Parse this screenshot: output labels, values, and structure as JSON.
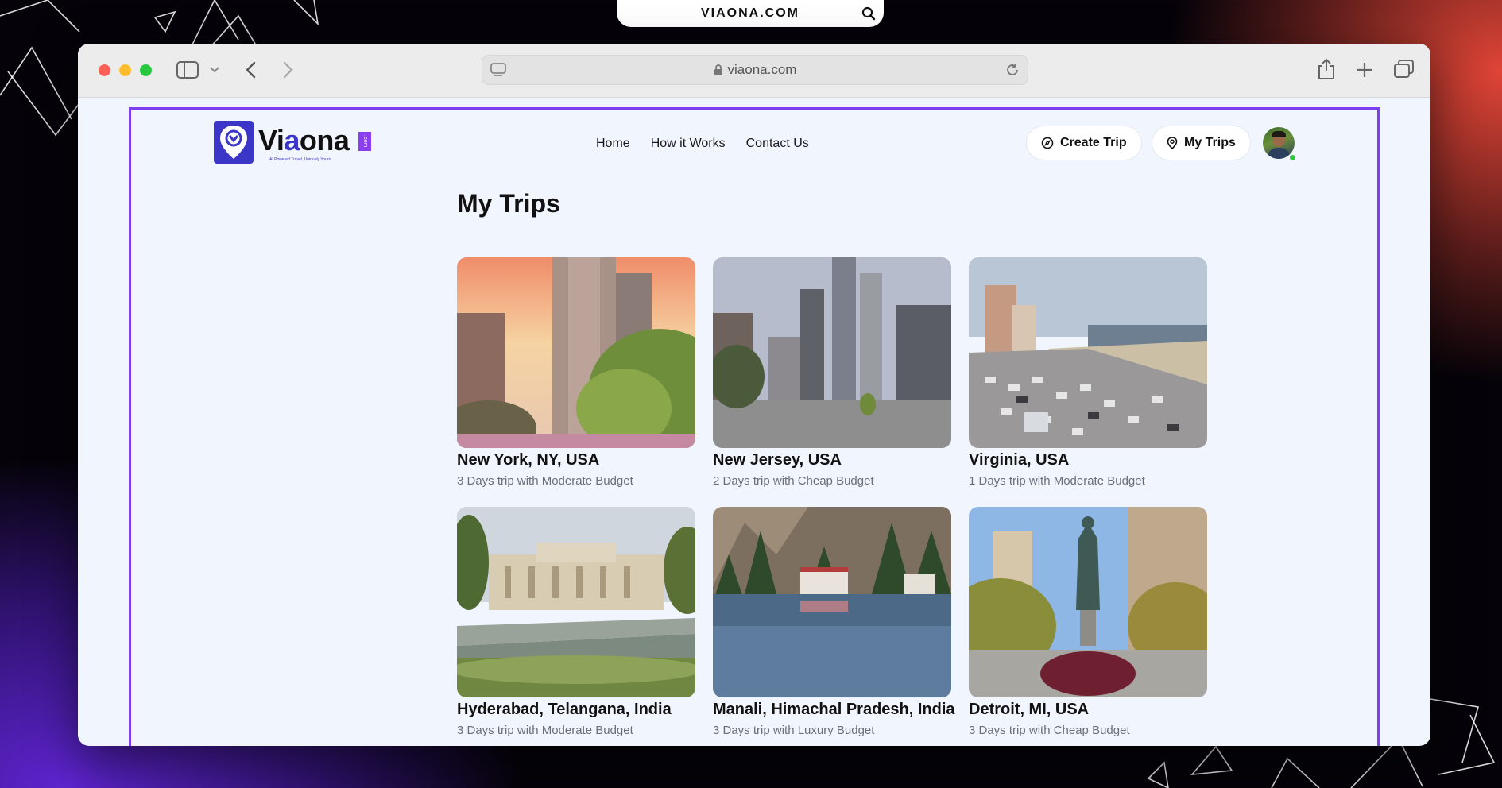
{
  "browser": {
    "top_label": "VIAONA.COM",
    "address": "viaona.com"
  },
  "header": {
    "logo_text_start": "Vi",
    "logo_text_a": "a",
    "logo_text_end": "ona",
    "logo_com": ".com",
    "logo_tagline": "AI Powered Travel, Uniquely Yours",
    "nav": [
      "Home",
      "How it Works",
      "Contact Us"
    ],
    "create_trip_label": "Create Trip",
    "my_trips_label": "My Trips"
  },
  "main": {
    "title": "My Trips",
    "trips": [
      {
        "place": "New York, NY, USA",
        "description": "3 Days trip with Moderate Budget"
      },
      {
        "place": "New Jersey, USA",
        "description": "2 Days trip with Cheap Budget"
      },
      {
        "place": "Virginia, USA",
        "description": "1 Days trip with Moderate Budget"
      },
      {
        "place": "Hyderabad, Telangana, India",
        "description": "3 Days trip with Moderate Budget"
      },
      {
        "place": "Manali, Himachal Pradesh, India",
        "description": "3 Days trip with Luxury Budget"
      },
      {
        "place": "Detroit, MI, USA",
        "description": "3 Days trip with Cheap Budget"
      }
    ]
  },
  "colors": {
    "accent": "#7d3ff0",
    "brand": "#3b35c8",
    "page_bg": "#f1f5fe",
    "online": "#37c24a"
  },
  "icons": {
    "create_trip": "compass-icon",
    "my_trips": "map-pin-icon",
    "address_lock": "lock-icon",
    "address_reload": "reload-icon"
  }
}
